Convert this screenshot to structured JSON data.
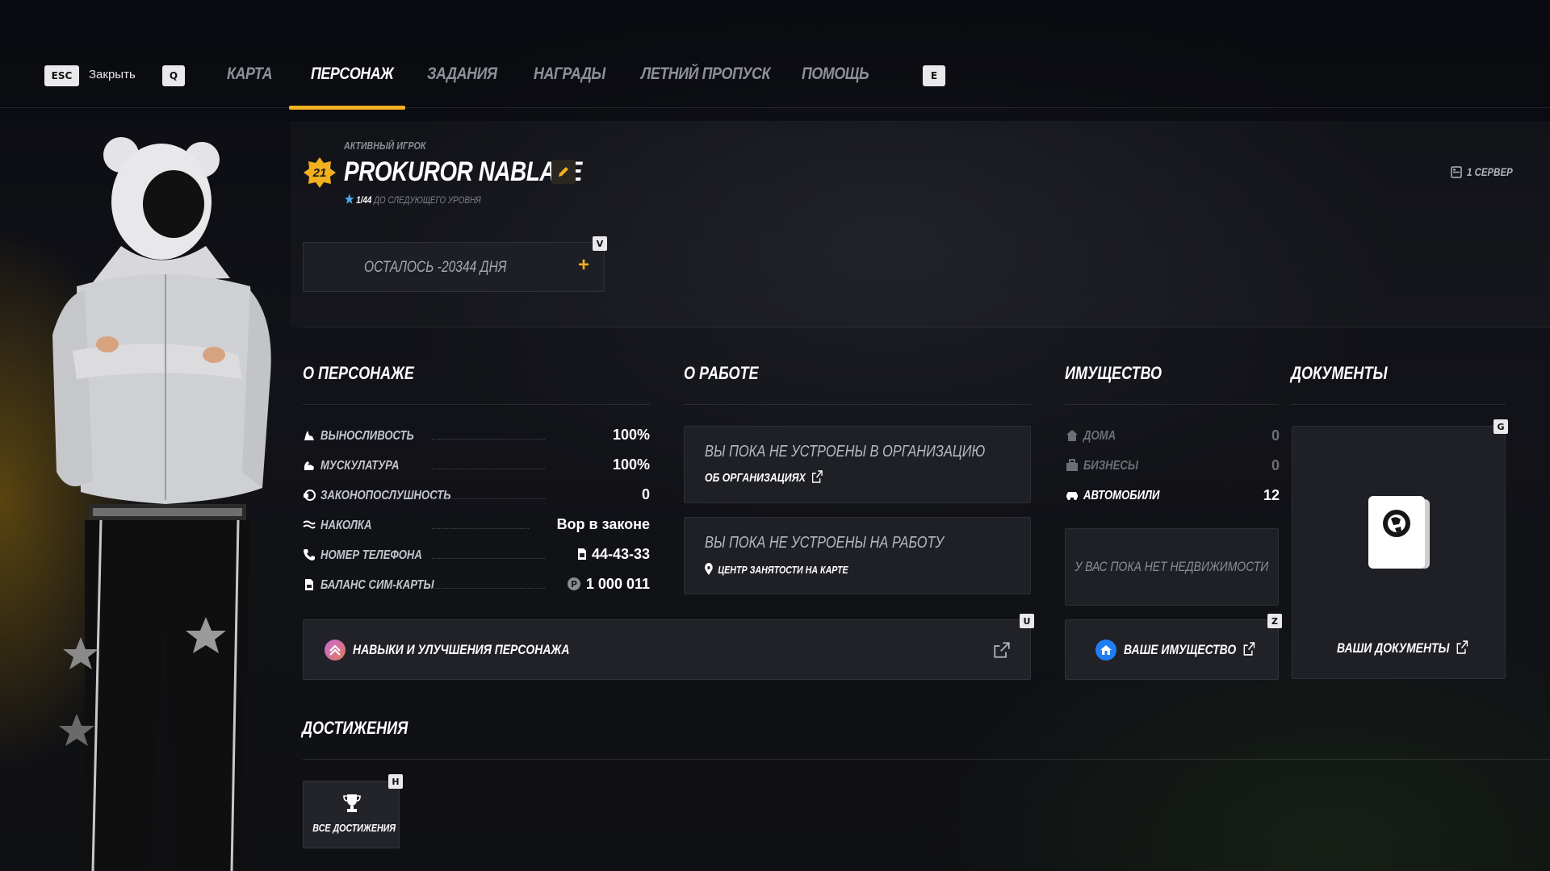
{
  "nav": {
    "close_key": "ESC",
    "close_label": "Закрыть",
    "prev_key": "Q",
    "next_key": "E",
    "tabs": [
      {
        "label": "КАРТА",
        "active": false
      },
      {
        "label": "ПЕРСОНАЖ",
        "active": true
      },
      {
        "label": "ЗАДАНИЯ",
        "active": false
      },
      {
        "label": "НАГРАДЫ",
        "active": false
      },
      {
        "label": "ЛЕТНИЙ ПРОПУСК",
        "active": false
      },
      {
        "label": "ПОМОЩЬ",
        "active": false
      }
    ],
    "accent": "#f2b01e"
  },
  "player": {
    "status": "АКТИВНЫЙ ИГРОК",
    "level": "21",
    "name": "PROKUROR NABLATE",
    "progress_current": "1",
    "progress_total": "/44",
    "progress_suffix": "ДО СЛЕДУЮЩЕГО УРОВНЯ",
    "server": "1 СЕРВЕР",
    "days_key": "V",
    "days_left": "ОСТАЛОСЬ -20344 ДНЯ",
    "days_add": "+"
  },
  "about": {
    "title": "О ПЕРСОНАЖЕ",
    "stats": [
      {
        "icon": "stamina-icon",
        "label": "ВЫНОСЛИВОСТЬ",
        "value": "100%"
      },
      {
        "icon": "muscle-icon",
        "label": "МУСКУЛАТУРА",
        "value": "100%"
      },
      {
        "icon": "law-icon",
        "label": "ЗАКОНОПОСЛУШНОСТЬ",
        "value": "0"
      },
      {
        "icon": "tattoo-icon",
        "label": "НАКОЛКА",
        "value": "Вор в законе"
      },
      {
        "icon": "phone-icon",
        "label": "НОМЕР ТЕЛЕФОНА",
        "value": "44-43-33"
      },
      {
        "icon": "sim-icon",
        "label": "БАЛАНС СИМ-КАРТЫ",
        "value": "1 000 011"
      }
    ],
    "skills_key": "U",
    "skills_label": "НАВЫКИ И УЛУЧШЕНИЯ ПЕРСОНАЖА"
  },
  "work": {
    "title": "О РАБОТЕ",
    "org_text": "ВЫ ПОКА НЕ УСТРОЕНЫ В ОРГАНИЗАЦИЮ",
    "org_link": "ОБ ОРГАНИЗАЦИЯХ",
    "job_text": "ВЫ ПОКА НЕ УСТРОЕНЫ НА РАБОТУ",
    "job_link": "ЦЕНТР ЗАНЯТОСТИ НА КАРТЕ"
  },
  "property": {
    "title": "ИМУЩЕСТВО",
    "items": [
      {
        "label": "ДОМА",
        "value": "0",
        "dim": true
      },
      {
        "label": "БИЗНЕСЫ",
        "value": "0",
        "dim": true
      },
      {
        "label": "АВТОМОБИЛИ",
        "value": "12",
        "dim": false
      }
    ],
    "empty_text": "У ВАС ПОКА НЕТ НЕДВИЖИМОСТИ",
    "button_key": "Z",
    "button_label": "ВАШЕ ИМУЩЕСТВО"
  },
  "documents": {
    "title": "ДОКУМЕНТЫ",
    "key": "G",
    "button_label": "ВАШИ ДОКУМЕНТЫ"
  },
  "achievements": {
    "title": "ДОСТИЖЕНИЯ",
    "key": "H",
    "tile_label": "ВСЕ ДОСТИЖЕНИЯ"
  }
}
